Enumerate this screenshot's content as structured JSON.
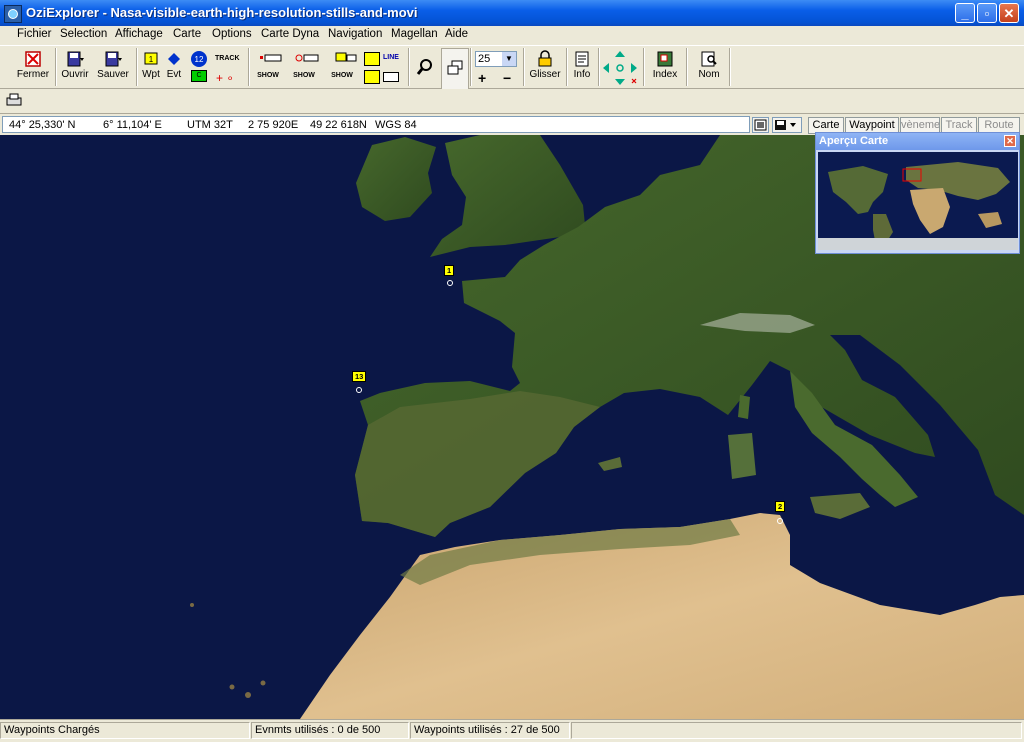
{
  "window": {
    "title": "OziExplorer - Nasa-visible-earth-high-resolution-stills-and-movi"
  },
  "menu": [
    "Fichier",
    "Selection",
    "Affichage",
    "Carte",
    "Options",
    "Carte Dyna",
    "Navigation",
    "Magellan",
    "Aide"
  ],
  "toolbar": {
    "fermer": "Fermer",
    "ouvrir": "Ouvrir",
    "sauver": "Sauver",
    "wpt": "Wpt",
    "evt": "Evt",
    "badge_12": "12",
    "track": "TRACK",
    "show": "SHOW",
    "line": "LINE",
    "zoom_value": "25",
    "glisser": "Glisser",
    "info": "Info",
    "index": "Index",
    "nom": "Nom"
  },
  "coords": {
    "lat": "44° 25,330' N",
    "lon": "6° 11,104' E",
    "utm": "UTM  32T",
    "easting": "2 75 920E",
    "northing": "49 22 618N",
    "datum": "WGS 84"
  },
  "tabs": [
    "Carte",
    "Waypoint",
    "vèneme",
    "Track",
    "Route"
  ],
  "overview": {
    "title": "Aperçu Carte",
    "close": "✕"
  },
  "waypoints": [
    {
      "label": "1"
    },
    {
      "label": "13"
    },
    {
      "label": "2"
    }
  ],
  "status": {
    "loaded": "Waypoints Chargés",
    "events": "Evnmts utilisés : 0 de 500",
    "waypoints": "Waypoints utilisés : 27 de 500"
  },
  "colors": {
    "sea": "#0b1746",
    "land": "#3f5e28",
    "desert": "#d4b284",
    "titlebar": "#0a5ee8"
  }
}
